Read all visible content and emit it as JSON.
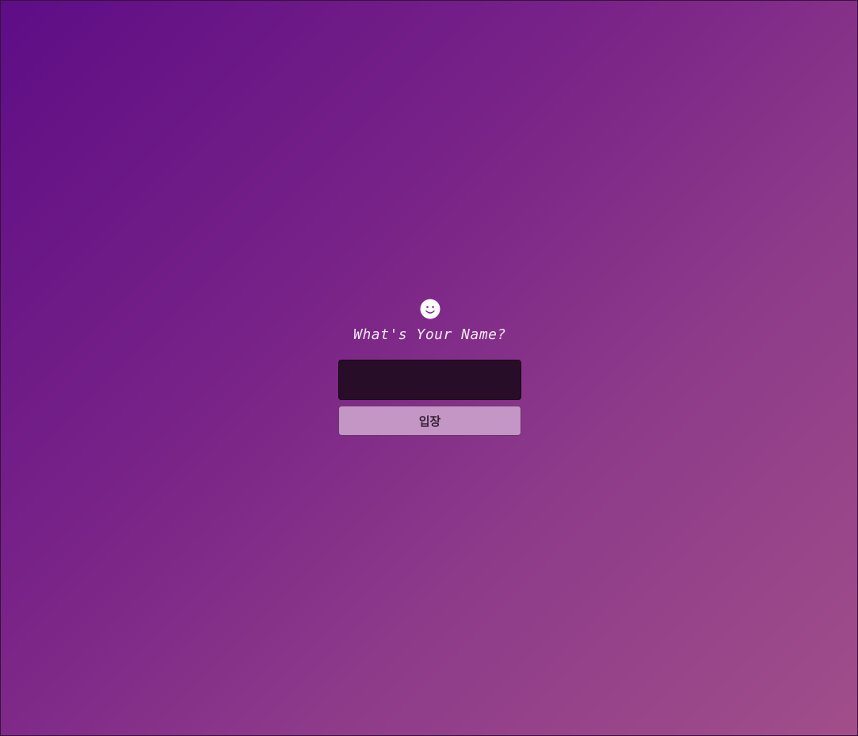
{
  "login": {
    "icon": "smile-icon",
    "title": "What's Your Name?",
    "name_input": {
      "value": "",
      "placeholder": ""
    },
    "enter_button_label": "입장"
  },
  "colors": {
    "background_start": "#5e0d86",
    "background_end": "#a14e8a",
    "input_background": "#270d28",
    "button_background": "#c396c6",
    "title_text": "#f3e8f5"
  }
}
